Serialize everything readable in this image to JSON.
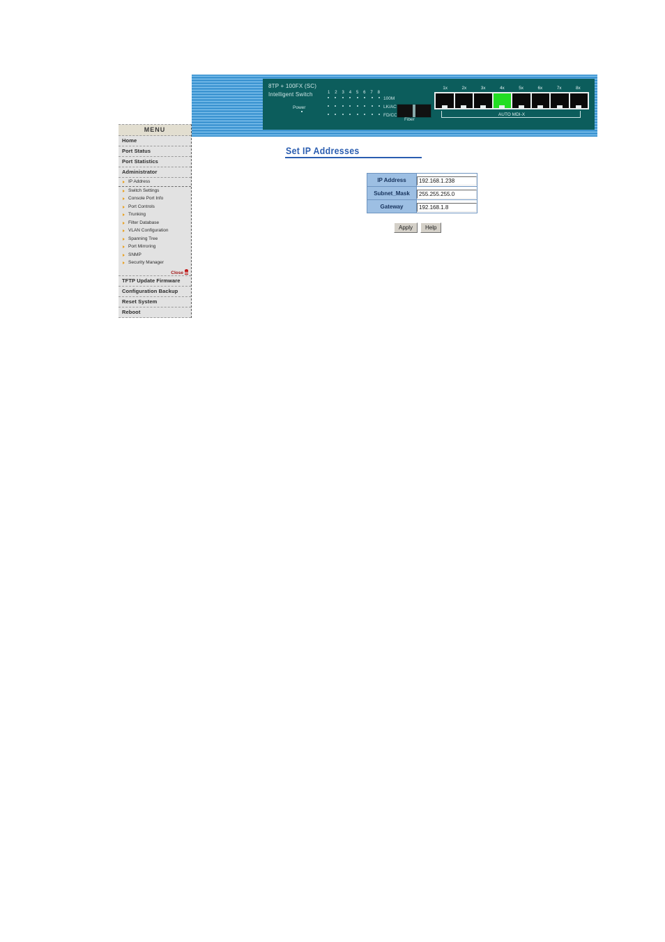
{
  "banner": {
    "device": {
      "model": "8TP + 100FX (SC)",
      "subtitle": "Intelligent Switch",
      "power_label": "Power",
      "port_numbers": [
        "1",
        "2",
        "3",
        "4",
        "5",
        "6",
        "7",
        "8"
      ],
      "led_rows": [
        {
          "label": "100M"
        },
        {
          "label": "LK/ACT"
        },
        {
          "label": "FD/COL"
        }
      ],
      "fiber_label": "Fiber",
      "port_labels": [
        "1x",
        "2x",
        "3x",
        "4x",
        "5x",
        "6x",
        "7x",
        "8x"
      ],
      "active_port_index": 3,
      "mdix_label": "AUTO MDI-X"
    }
  },
  "sidebar": {
    "header": "MENU",
    "items": [
      {
        "label": "Home",
        "type": "top"
      },
      {
        "label": "Port Status",
        "type": "top"
      },
      {
        "label": "Port Statistics",
        "type": "top"
      },
      {
        "label": "Administrator",
        "type": "top"
      },
      {
        "label": "IP Address",
        "type": "sub",
        "selected": true
      },
      {
        "label": "Switch Settings",
        "type": "sub"
      },
      {
        "label": "Console Port Info",
        "type": "sub"
      },
      {
        "label": "Port Controls",
        "type": "sub"
      },
      {
        "label": "Trunking",
        "type": "sub"
      },
      {
        "label": "Filter Database",
        "type": "sub"
      },
      {
        "label": "VLAN Configuration",
        "type": "sub"
      },
      {
        "label": "Spanning Tree",
        "type": "sub"
      },
      {
        "label": "Port Mirroring",
        "type": "sub"
      },
      {
        "label": "SNMP",
        "type": "sub"
      },
      {
        "label": "Security Manager",
        "type": "sub"
      },
      {
        "label": "Close",
        "type": "close"
      },
      {
        "label": "TFTP Update Firmware",
        "type": "top"
      },
      {
        "label": "Configuration Backup",
        "type": "top"
      },
      {
        "label": "Reset System",
        "type": "top"
      },
      {
        "label": "Reboot",
        "type": "top"
      }
    ]
  },
  "main": {
    "title": "Set IP Addresses",
    "fields": [
      {
        "label": "IP Address",
        "value": "192.168.1.238"
      },
      {
        "label": "Subnet_Mask",
        "value": "255.255.255.0"
      },
      {
        "label": "Gateway",
        "value": "192.168.1.8"
      }
    ],
    "buttons": [
      {
        "label": "Apply"
      },
      {
        "label": "Help"
      }
    ]
  },
  "colors": {
    "accent_blue": "#2a5db0",
    "label_cell": "#9dbfe3",
    "device_panel": "#0c5d5c",
    "active_port": "#22dd22",
    "close_red": "#a01515",
    "bullet_orange": "#e8a020"
  }
}
